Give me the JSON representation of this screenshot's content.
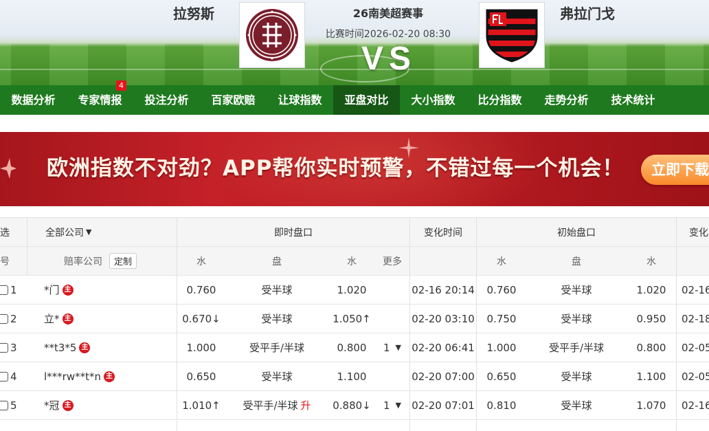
{
  "match": {
    "home_team": "拉努斯",
    "away_team": "弗拉门戈",
    "league": "26南美超赛事",
    "time_label": "比赛时间2026-02-20 08:30",
    "vs_label": "VS"
  },
  "nav": {
    "items": [
      {
        "label": "数据分析",
        "active": false
      },
      {
        "label": "专家情报",
        "active": false,
        "badge": "4"
      },
      {
        "label": "投注分析",
        "active": false
      },
      {
        "label": "百家欧赔",
        "active": false
      },
      {
        "label": "让球指数",
        "active": false
      },
      {
        "label": "亚盘对比",
        "active": true
      },
      {
        "label": "大小指数",
        "active": false
      },
      {
        "label": "比分指数",
        "active": false
      },
      {
        "label": "走势分析",
        "active": false
      },
      {
        "label": "技术统计",
        "active": false
      }
    ]
  },
  "banner": {
    "text": "欧洲指数不对劲？APP帮你实时预警，不错过每一个机会！",
    "button_label": "立即下载"
  },
  "table": {
    "header1": {
      "filter": "筛选",
      "company_select": "全部公司",
      "live": "即时盘口",
      "change_time": "变化时间",
      "initial": "初始盘口",
      "change2": "变化"
    },
    "header2": {
      "index": "序号",
      "company": "赔率公司",
      "customize": "定制",
      "water1": "水",
      "handicap": "盘",
      "water2": "水",
      "more": "更多",
      "init_water1": "水",
      "init_handicap": "盘",
      "init_water2": "水"
    },
    "zhu_icon_label": "主",
    "rows": [
      {
        "no": "1",
        "company": "*门",
        "w1": "0.760",
        "w1_dir": "",
        "pan": "受半球",
        "pan_tag": "",
        "w2": "1.020",
        "w2_dir": "",
        "more": "",
        "time": "02-16 20:14",
        "iw1": "0.760",
        "ipan": "受半球",
        "iw2": "1.020",
        "t2": "02-16"
      },
      {
        "no": "2",
        "company": "立*",
        "w1": "0.670↓",
        "w1_dir": "down",
        "pan": "受半球",
        "pan_tag": "",
        "w2": "1.050↑",
        "w2_dir": "up",
        "more": "",
        "time": "02-20 03:10",
        "iw1": "0.750",
        "ipan": "受半球",
        "iw2": "0.950",
        "t2": "02-18"
      },
      {
        "no": "3",
        "company": "**t3*5",
        "w1": "1.000",
        "w1_dir": "",
        "pan": "受平手/半球",
        "pan_tag": "",
        "w2": "0.800",
        "w2_dir": "",
        "more": "1",
        "time": "02-20 06:41",
        "iw1": "1.000",
        "ipan": "受平手/半球",
        "iw2": "0.800",
        "t2": "02-05"
      },
      {
        "no": "4",
        "company": "l***rw**t*n",
        "w1": "0.650",
        "w1_dir": "",
        "pan": "受半球",
        "pan_tag": "",
        "w2": "1.100",
        "w2_dir": "",
        "more": "",
        "time": "02-20 07:00",
        "iw1": "0.650",
        "ipan": "受半球",
        "iw2": "1.100",
        "t2": "02-05"
      },
      {
        "no": "5",
        "company": "*冠",
        "w1": "1.010↑",
        "w1_dir": "up",
        "pan": "受平手/半球",
        "pan_tag": "升",
        "w2": "0.880↓",
        "w2_dir": "down",
        "more": "1",
        "time": "02-20 07:01",
        "iw1": "0.810",
        "ipan": "受半球",
        "iw2": "1.070",
        "t2": "02-16"
      }
    ]
  },
  "colors": {
    "nav_bg": "#1f7a1f",
    "nav_active": "#165716",
    "up": "#e8141b",
    "down": "#1a9a1a",
    "banner_red": "#c42129",
    "button_orange": "#f98a2b"
  }
}
